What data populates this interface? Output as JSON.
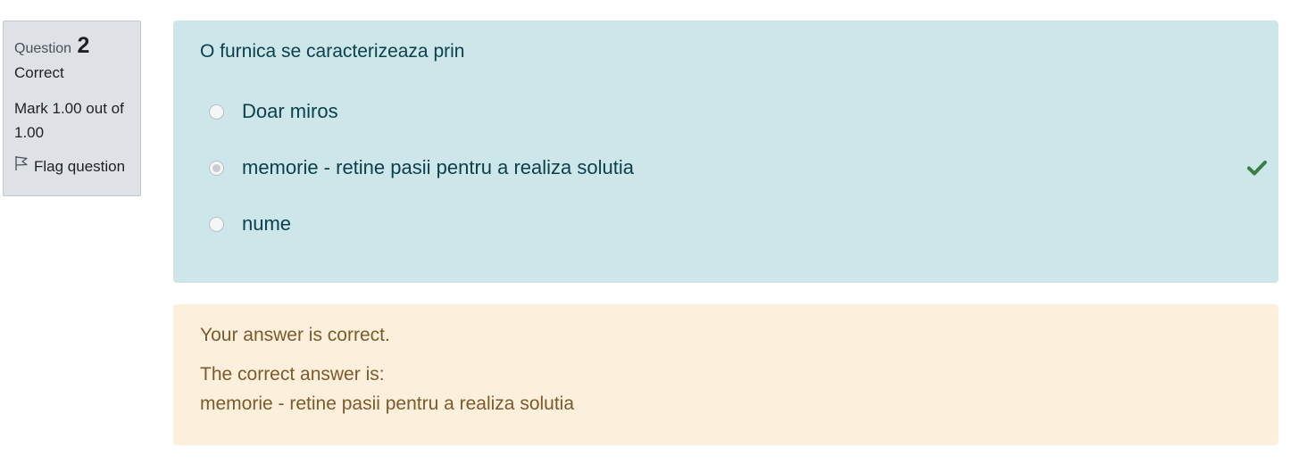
{
  "info": {
    "question_label": "Question",
    "question_number": "2",
    "state": "Correct",
    "grade": "Mark 1.00 out of 1.00",
    "flag_label": "Flag question"
  },
  "question": {
    "text": "O furnica se caracterizeaza prin",
    "answers": [
      {
        "label": "Doar miros",
        "selected": false,
        "correct": false
      },
      {
        "label": "memorie - retine pasii pentru a realiza solutia",
        "selected": true,
        "correct": true
      },
      {
        "label": "nume",
        "selected": false,
        "correct": false
      }
    ]
  },
  "feedback": {
    "result": "Your answer is correct.",
    "right_answer_intro": "The correct answer is:",
    "right_answer": "memorie - retine pasii pentru a realiza solutia"
  },
  "colors": {
    "formulation_bg": "#cce6ea",
    "feedback_bg": "#fcefdc",
    "check_green": "#3a7f42"
  }
}
